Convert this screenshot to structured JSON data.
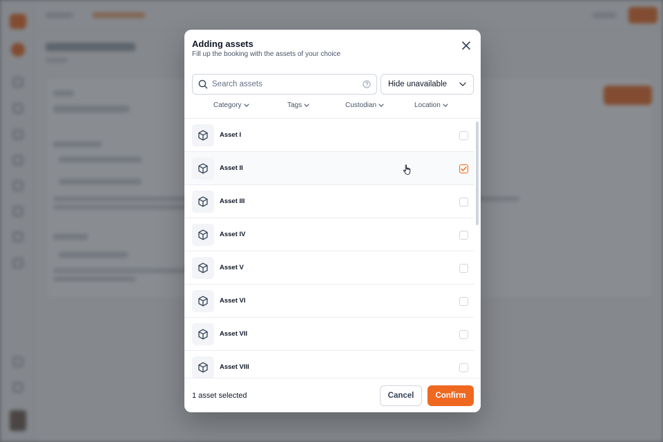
{
  "modal": {
    "title": "Adding assets",
    "subtitle": "Fill up the booking with the assets of your choice"
  },
  "search": {
    "placeholder": "Search assets"
  },
  "availability_select": {
    "selected": "Hide unavailable"
  },
  "filters": [
    {
      "label": "Category"
    },
    {
      "label": "Tags"
    },
    {
      "label": "Custodian"
    },
    {
      "label": "Location"
    }
  ],
  "assets": [
    {
      "name": "Asset I",
      "checked": false
    },
    {
      "name": "Asset II",
      "checked": true
    },
    {
      "name": "Asset III",
      "checked": false
    },
    {
      "name": "Asset IV",
      "checked": false
    },
    {
      "name": "Asset V",
      "checked": false
    },
    {
      "name": "Asset VI",
      "checked": false
    },
    {
      "name": "Asset VII",
      "checked": false
    },
    {
      "name": "Asset VIII",
      "checked": false
    }
  ],
  "footer": {
    "selected_count": "1 asset selected",
    "cancel_label": "Cancel",
    "confirm_label": "Confirm"
  },
  "icons": {
    "close": "close-icon",
    "search": "search-icon",
    "help": "help-circle-icon",
    "chevron": "chevron-down-icon",
    "asset": "package-box-icon",
    "check": "check-icon",
    "cursor": "hand-pointer-icon"
  },
  "colors": {
    "accent": "#ef6820",
    "text": "#101828",
    "muted": "#475467",
    "border": "#d0d5dd"
  }
}
